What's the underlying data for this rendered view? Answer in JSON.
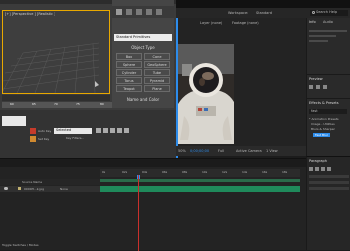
{
  "max": {
    "viewport_label": "[+] [Perspective ] [Realistic ]",
    "primitive_dropdown": "Standard Primitives",
    "object_type_title": "Object Type",
    "primitives": [
      "Box",
      "Cone",
      "Sphere",
      "GeoSphere",
      "Cylinder",
      "Tube",
      "Torus",
      "Pyramid",
      "Teapot",
      "Plane"
    ],
    "name_color_title": "Name and Color",
    "timeline_labels": [
      "60",
      "65",
      "70",
      "75",
      "80",
      "85"
    ],
    "selection_lock_label": "Selected",
    "autokey_label": "Auto Key",
    "setkey_label": "Set Key",
    "key_filters_label": "Key Filters..."
  },
  "ae": {
    "workspace_label": "Workspace:",
    "workspace_value": "Standard",
    "search_help_placeholder": "Search Help",
    "layer_tab": "Layer (none)",
    "footage_tab": "Footage (none)",
    "zoom_value": "50%",
    "timecode": "0;00;00;00",
    "resolution": "Full",
    "active_camera": "Active Camera",
    "view_count": "1 View",
    "info_panel_title": "Info",
    "audio_label": "Audio",
    "preview_title": "Preview",
    "effects_title": "Effects & Presets",
    "effects_search": "fast",
    "effects_items": [
      "* Animation Presets",
      "Image - Utilities",
      "Blurs & Sharpen",
      "Fast Blur"
    ],
    "paragraph_title": "Paragraph",
    "layer_row_name": "0000H...k.jpg",
    "layer_mode": "None",
    "source_name_header": "Source Name",
    "ruler_marks": [
      "0s",
      "02s",
      "04s",
      "06s",
      "08s",
      "10s",
      "12s",
      "14s",
      "16s",
      "18s"
    ],
    "toggle_switches_label": "Toggle Switches / Modes"
  },
  "colors": {
    "ae_blue": "#2d8ceb",
    "max_gray": "#444444",
    "timeline_green": "#1f8a5b",
    "max_orange_border": "#e8a800"
  }
}
